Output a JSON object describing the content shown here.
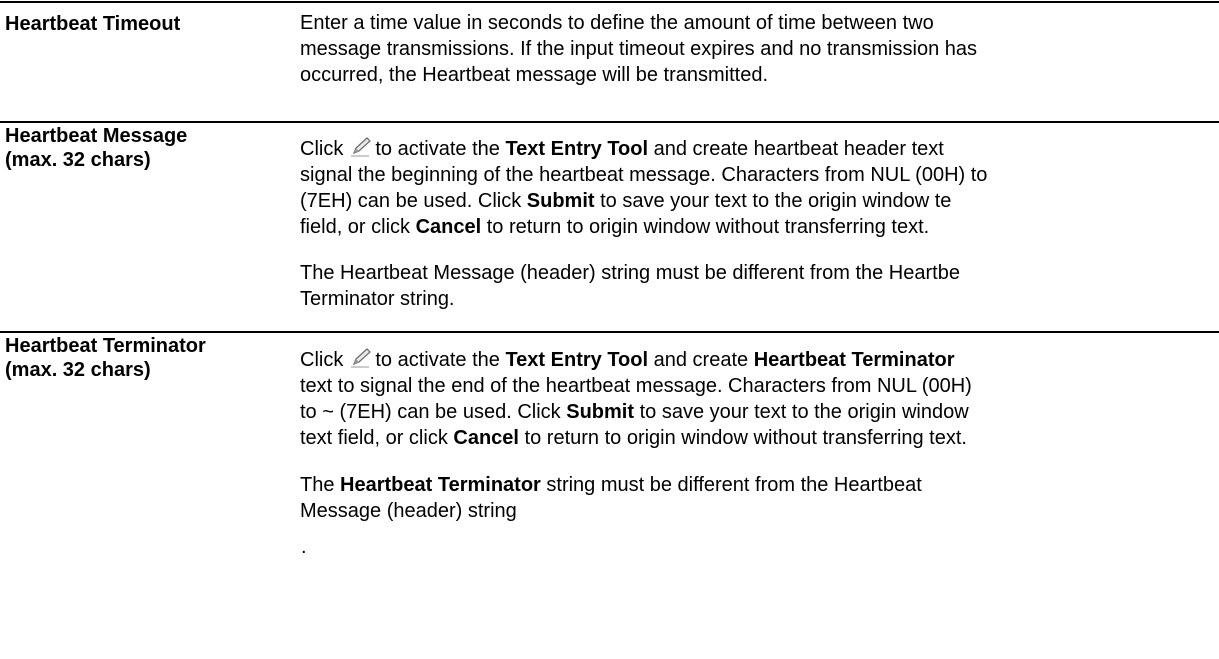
{
  "rows": [
    {
      "term": "Heartbeat Timeout",
      "lines": [
        "Enter a time value in seconds to define the amount of time between two",
        "message transmissions. If the input timeout expires and no transmission has",
        "occurred, the Heartbeat message will be transmitted."
      ]
    },
    {
      "term_line1": "Heartbeat Message",
      "term_line2": "(max. 32 chars)",
      "click": "Click",
      "l1_a": "to activate the",
      "l1_bold": "Text Entry Tool",
      "l1_b": "and create heartbeat header text",
      "l2": "signal the beginning of the heartbeat message. Characters from NUL (00H) to",
      "l3": "(7EH) can be used. Click",
      "l3_bold": "Submit",
      "l3_b": "to save your text to the origin window te",
      "l4_a": "field, or click",
      "l4_bold": "Cancel",
      "l4_b": "to return to origin window without transferring text.",
      "p2_l1": "The Heartbeat Message (header) string must be different from the Heartbe",
      "p2_l2": "Terminator string."
    },
    {
      "term_line1": "Heartbeat Terminator",
      "term_line2": "(max. 32 chars)",
      "click": "Click",
      "l1_a": "to activate the",
      "l1_bold": "Text Entry Tool",
      "l1_b": "and create",
      "l1_bold2": "Heartbeat Terminator",
      "l2": "text to signal the end of the heartbeat message. Characters from NUL (00H)",
      "l3": "to ~ (7EH) can be used. Click",
      "l3_bold": "Submit",
      "l3_b": "to save your text to the origin window",
      "l4_a": "text field, or click",
      "l4_bold": "Cancel",
      "l4_b": "to return to origin window without transferring text.",
      "p2_a": "The",
      "p2_bold": "Heartbeat Terminator",
      "p2_b": "string must be different from the Heartbeat",
      "p2_l2": "Message (header) string",
      "p3": "."
    }
  ],
  "icons": {
    "edit": "pencil-icon"
  }
}
